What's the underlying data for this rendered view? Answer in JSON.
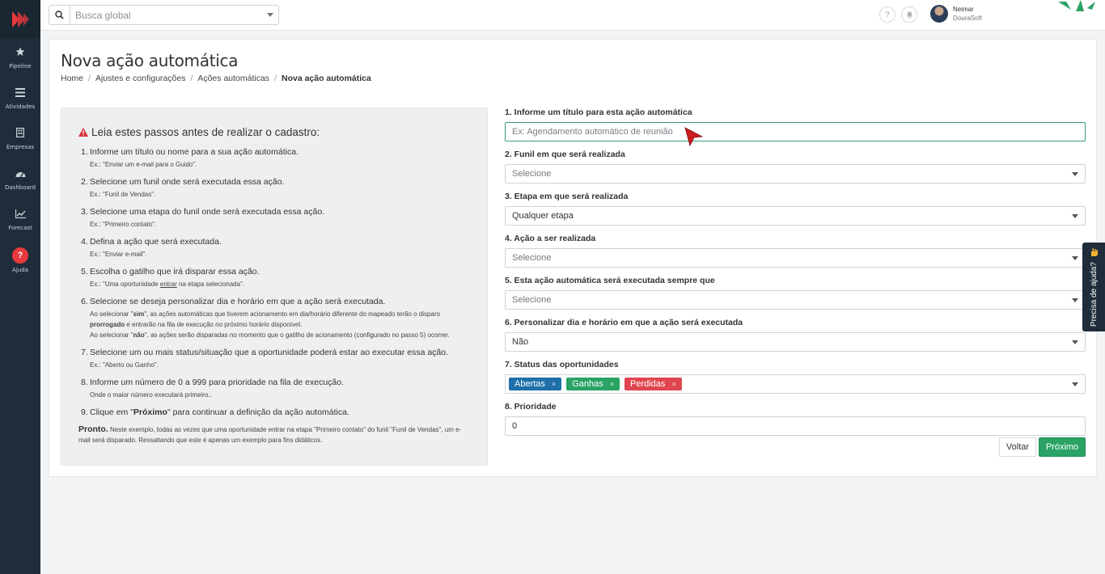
{
  "app": {
    "sidebar": [
      {
        "icon": "star-icon",
        "label": "Pipeline"
      },
      {
        "icon": "list-icon",
        "label": "Atividades"
      },
      {
        "icon": "building-icon",
        "label": "Empresas"
      },
      {
        "icon": "dashboard-icon",
        "label": "Dashboard"
      },
      {
        "icon": "chart-line-icon",
        "label": "Forecast"
      },
      {
        "icon": "question-icon",
        "label": "Ajuda"
      }
    ]
  },
  "topbar": {
    "search_placeholder": "Busca global",
    "help_symbol": "?",
    "user_name": "Neimar",
    "user_company": "DouraSoft"
  },
  "page": {
    "title": "Nova ação automática",
    "breadcrumb": [
      "Home",
      "Ajustes e configurações",
      "Ações automáticas",
      "Nova ação automática"
    ]
  },
  "info": {
    "heading": "Leia estes passos antes de realizar o cadastro:",
    "steps": [
      {
        "num": "1.",
        "text": "Informe um título ou nome para a sua ação automática.",
        "ex": "Ex.: \"Enviar um e-mail para o Guido\"."
      },
      {
        "num": "2.",
        "text": "Selecione um funil onde será executada essa ação.",
        "ex": "Ex.: \"Funil de Vendas\"."
      },
      {
        "num": "3.",
        "text": "Selecione uma etapa do funil onde será executada essa ação.",
        "ex": "Ex.: \"Primeiro contato\"."
      },
      {
        "num": "4.",
        "text": "Defina a ação que será executada.",
        "ex": "Ex.: \"Enviar e-mail\"."
      },
      {
        "num": "5.",
        "text": "Escolha o gatilho que irá disparar essa ação.",
        "ex_a": "Ex.: \"Uma oportunidade ",
        "ex_u": "entrar",
        "ex_b": " na etapa selecionada\"."
      },
      {
        "num": "6.",
        "text": "Selecione se deseja personalizar dia e horário em que a ação será executada.",
        "l1a": "Ao selecionar \"",
        "l1b": "sim",
        "l1c": "\", as ações automáticas que tiverem acionamento em dia/horário diferente do mapeado terão o disparo",
        "l2a": "prorrogado",
        "l2b": " e entrarão na fila de execução no próximo horário disponível.",
        "l3a": "Ao selecionar \"",
        "l3b": "não",
        "l3c": "\", as ações serão disparadas no momento que o gatilho de acionamento (configurado no passo 5) ocorrer."
      },
      {
        "num": "7.",
        "text": "Selecione um ou mais status/situação que a oportunidade poderá estar ao executar essa ação.",
        "ex": "Ex.: \"Aberto ou Ganho\"."
      },
      {
        "num": "8.",
        "text": "Informe um número de 0 a 999 para prioridade na fila de execução.",
        "ex": "Onde o maior número executará primeiro.."
      },
      {
        "num": "9.",
        "text_a": "Clique em \"",
        "text_b": "Próximo",
        "text_c": "\" para continuar a definição da ação automática."
      }
    ],
    "pronto_label": "Pronto.",
    "pronto_text": " Neste exemplo, todas as vezes que uma oportunidade entrar na etapa \"Primeiro contato\" do funil \"Funil de Vendas\", um e-mail será disparado. Ressaltando que este é apenas um exemplo para fins didáticos."
  },
  "form": {
    "title_label": "1. Informe um título para esta ação automática",
    "title_placeholder": "Ex: Agendamento automático de reunião",
    "funnel_label": "2. Funil em que será realizada",
    "funnel_value": "Selecione",
    "stage_label": "3. Etapa em que será realizada",
    "stage_value": "Qualquer etapa",
    "action_label": "4. Ação a ser realizada",
    "action_value": "Selecione",
    "trigger_label": "5. Esta ação automática será executada sempre que",
    "trigger_value": "Selecione",
    "schedule_label": "6. Personalizar dia e horário em que a ação será executada",
    "schedule_value": "Não",
    "status_label": "7. Status das oportunidades",
    "status_tags": [
      {
        "label": "Abertas",
        "color": "#1f6fa8"
      },
      {
        "label": "Ganhas",
        "color": "#2aa365"
      },
      {
        "label": "Perdidas",
        "color": "#e04650"
      }
    ],
    "tag_remove": "×",
    "priority_label": "8. Prioridade",
    "priority_value": "0",
    "back_button": "Voltar",
    "next_button": "Próximo"
  },
  "help_tab": {
    "label": "Precisa de ajuda?"
  }
}
